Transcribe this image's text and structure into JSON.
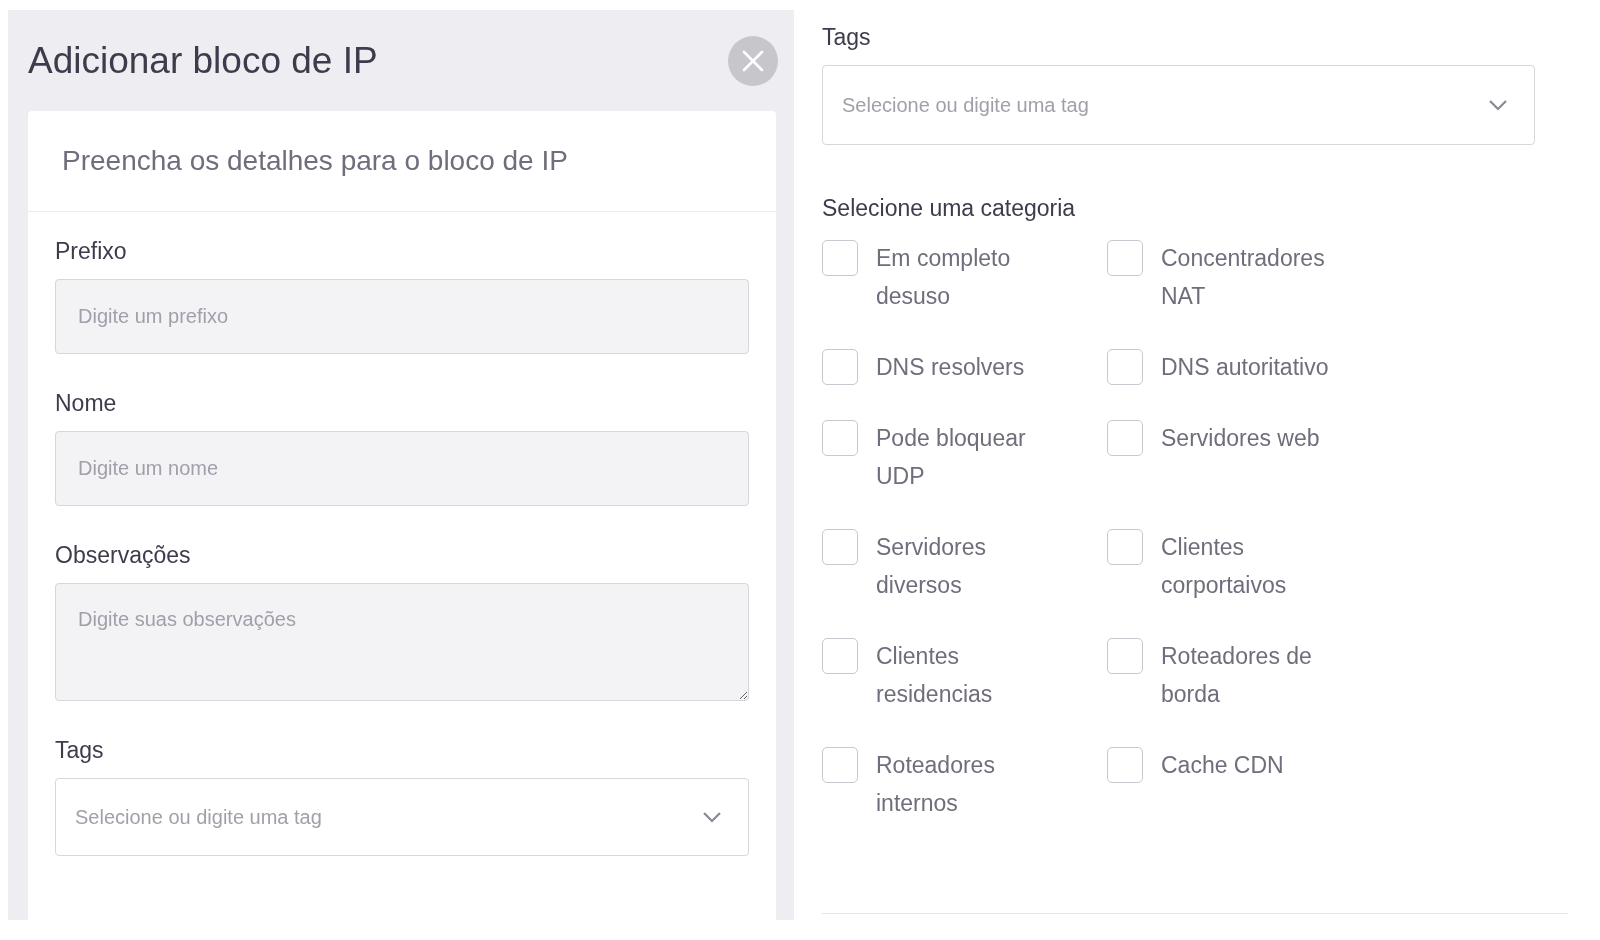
{
  "left_panel": {
    "title": "Adicionar bloco de IP",
    "card": {
      "heading": "Preencha os detalhes para o bloco de IP",
      "fields": [
        {
          "kind": "input",
          "label": "Prefixo",
          "placeholder": "Digite um prefixo"
        },
        {
          "kind": "input",
          "label": "Nome",
          "placeholder": "Digite um nome"
        },
        {
          "kind": "textarea",
          "label": "Observações",
          "placeholder": "Digite suas observações"
        },
        {
          "kind": "select",
          "label": "Tags",
          "placeholder": "Selecione ou digite uma tag"
        }
      ]
    }
  },
  "right_panel": {
    "tags": {
      "label": "Tags",
      "placeholder": "Selecione ou digite uma tag"
    },
    "category_label": "Selecione uma categoria",
    "categories": [
      {
        "label": "Em completo desuso",
        "checked": false
      },
      {
        "label": "Concentradores NAT",
        "checked": false
      },
      {
        "label": "DNS resolvers",
        "checked": false
      },
      {
        "label": "DNS autoritativo",
        "checked": false
      },
      {
        "label": "Pode bloquear UDP",
        "checked": false
      },
      {
        "label": "Servidores web",
        "checked": false
      },
      {
        "label": "Servidores diversos",
        "checked": false
      },
      {
        "label": "Clientes corportaivos",
        "checked": false
      },
      {
        "label": "Clientes residencias",
        "checked": false
      },
      {
        "label": "Roteadores de borda",
        "checked": false
      },
      {
        "label": "Roteadores internos",
        "checked": false
      },
      {
        "label": "Cache CDN",
        "checked": false
      }
    ]
  }
}
